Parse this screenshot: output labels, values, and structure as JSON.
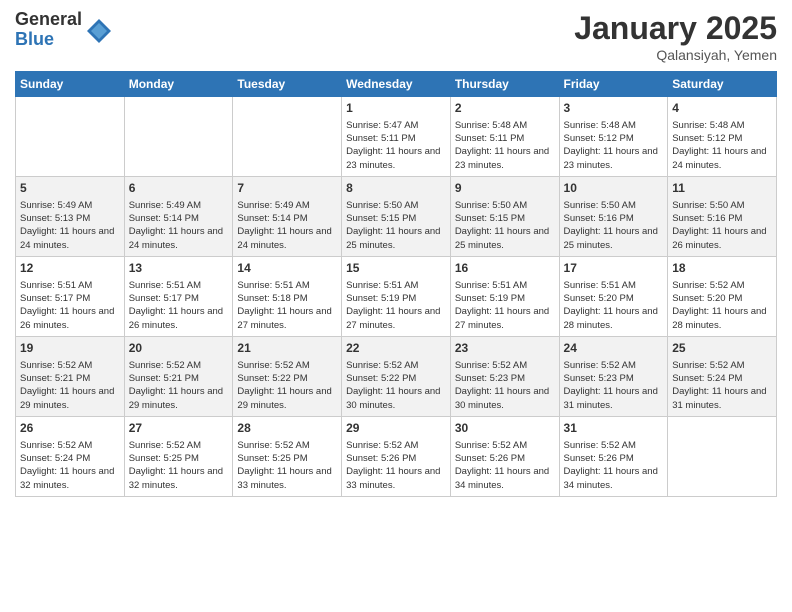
{
  "logo": {
    "general": "General",
    "blue": "Blue"
  },
  "header": {
    "month": "January 2025",
    "location": "Qalansiyah, Yemen"
  },
  "weekdays": [
    "Sunday",
    "Monday",
    "Tuesday",
    "Wednesday",
    "Thursday",
    "Friday",
    "Saturday"
  ],
  "weeks": [
    [
      {
        "day": "",
        "data": ""
      },
      {
        "day": "",
        "data": ""
      },
      {
        "day": "",
        "data": ""
      },
      {
        "day": "1",
        "sunrise": "Sunrise: 5:47 AM",
        "sunset": "Sunset: 5:11 PM",
        "daylight": "Daylight: 11 hours and 23 minutes."
      },
      {
        "day": "2",
        "sunrise": "Sunrise: 5:48 AM",
        "sunset": "Sunset: 5:11 PM",
        "daylight": "Daylight: 11 hours and 23 minutes."
      },
      {
        "day": "3",
        "sunrise": "Sunrise: 5:48 AM",
        "sunset": "Sunset: 5:12 PM",
        "daylight": "Daylight: 11 hours and 23 minutes."
      },
      {
        "day": "4",
        "sunrise": "Sunrise: 5:48 AM",
        "sunset": "Sunset: 5:12 PM",
        "daylight": "Daylight: 11 hours and 24 minutes."
      }
    ],
    [
      {
        "day": "5",
        "sunrise": "Sunrise: 5:49 AM",
        "sunset": "Sunset: 5:13 PM",
        "daylight": "Daylight: 11 hours and 24 minutes."
      },
      {
        "day": "6",
        "sunrise": "Sunrise: 5:49 AM",
        "sunset": "Sunset: 5:14 PM",
        "daylight": "Daylight: 11 hours and 24 minutes."
      },
      {
        "day": "7",
        "sunrise": "Sunrise: 5:49 AM",
        "sunset": "Sunset: 5:14 PM",
        "daylight": "Daylight: 11 hours and 24 minutes."
      },
      {
        "day": "8",
        "sunrise": "Sunrise: 5:50 AM",
        "sunset": "Sunset: 5:15 PM",
        "daylight": "Daylight: 11 hours and 25 minutes."
      },
      {
        "day": "9",
        "sunrise": "Sunrise: 5:50 AM",
        "sunset": "Sunset: 5:15 PM",
        "daylight": "Daylight: 11 hours and 25 minutes."
      },
      {
        "day": "10",
        "sunrise": "Sunrise: 5:50 AM",
        "sunset": "Sunset: 5:16 PM",
        "daylight": "Daylight: 11 hours and 25 minutes."
      },
      {
        "day": "11",
        "sunrise": "Sunrise: 5:50 AM",
        "sunset": "Sunset: 5:16 PM",
        "daylight": "Daylight: 11 hours and 26 minutes."
      }
    ],
    [
      {
        "day": "12",
        "sunrise": "Sunrise: 5:51 AM",
        "sunset": "Sunset: 5:17 PM",
        "daylight": "Daylight: 11 hours and 26 minutes."
      },
      {
        "day": "13",
        "sunrise": "Sunrise: 5:51 AM",
        "sunset": "Sunset: 5:17 PM",
        "daylight": "Daylight: 11 hours and 26 minutes."
      },
      {
        "day": "14",
        "sunrise": "Sunrise: 5:51 AM",
        "sunset": "Sunset: 5:18 PM",
        "daylight": "Daylight: 11 hours and 27 minutes."
      },
      {
        "day": "15",
        "sunrise": "Sunrise: 5:51 AM",
        "sunset": "Sunset: 5:19 PM",
        "daylight": "Daylight: 11 hours and 27 minutes."
      },
      {
        "day": "16",
        "sunrise": "Sunrise: 5:51 AM",
        "sunset": "Sunset: 5:19 PM",
        "daylight": "Daylight: 11 hours and 27 minutes."
      },
      {
        "day": "17",
        "sunrise": "Sunrise: 5:51 AM",
        "sunset": "Sunset: 5:20 PM",
        "daylight": "Daylight: 11 hours and 28 minutes."
      },
      {
        "day": "18",
        "sunrise": "Sunrise: 5:52 AM",
        "sunset": "Sunset: 5:20 PM",
        "daylight": "Daylight: 11 hours and 28 minutes."
      }
    ],
    [
      {
        "day": "19",
        "sunrise": "Sunrise: 5:52 AM",
        "sunset": "Sunset: 5:21 PM",
        "daylight": "Daylight: 11 hours and 29 minutes."
      },
      {
        "day": "20",
        "sunrise": "Sunrise: 5:52 AM",
        "sunset": "Sunset: 5:21 PM",
        "daylight": "Daylight: 11 hours and 29 minutes."
      },
      {
        "day": "21",
        "sunrise": "Sunrise: 5:52 AM",
        "sunset": "Sunset: 5:22 PM",
        "daylight": "Daylight: 11 hours and 29 minutes."
      },
      {
        "day": "22",
        "sunrise": "Sunrise: 5:52 AM",
        "sunset": "Sunset: 5:22 PM",
        "daylight": "Daylight: 11 hours and 30 minutes."
      },
      {
        "day": "23",
        "sunrise": "Sunrise: 5:52 AM",
        "sunset": "Sunset: 5:23 PM",
        "daylight": "Daylight: 11 hours and 30 minutes."
      },
      {
        "day": "24",
        "sunrise": "Sunrise: 5:52 AM",
        "sunset": "Sunset: 5:23 PM",
        "daylight": "Daylight: 11 hours and 31 minutes."
      },
      {
        "day": "25",
        "sunrise": "Sunrise: 5:52 AM",
        "sunset": "Sunset: 5:24 PM",
        "daylight": "Daylight: 11 hours and 31 minutes."
      }
    ],
    [
      {
        "day": "26",
        "sunrise": "Sunrise: 5:52 AM",
        "sunset": "Sunset: 5:24 PM",
        "daylight": "Daylight: 11 hours and 32 minutes."
      },
      {
        "day": "27",
        "sunrise": "Sunrise: 5:52 AM",
        "sunset": "Sunset: 5:25 PM",
        "daylight": "Daylight: 11 hours and 32 minutes."
      },
      {
        "day": "28",
        "sunrise": "Sunrise: 5:52 AM",
        "sunset": "Sunset: 5:25 PM",
        "daylight": "Daylight: 11 hours and 33 minutes."
      },
      {
        "day": "29",
        "sunrise": "Sunrise: 5:52 AM",
        "sunset": "Sunset: 5:26 PM",
        "daylight": "Daylight: 11 hours and 33 minutes."
      },
      {
        "day": "30",
        "sunrise": "Sunrise: 5:52 AM",
        "sunset": "Sunset: 5:26 PM",
        "daylight": "Daylight: 11 hours and 34 minutes."
      },
      {
        "day": "31",
        "sunrise": "Sunrise: 5:52 AM",
        "sunset": "Sunset: 5:26 PM",
        "daylight": "Daylight: 11 hours and 34 minutes."
      },
      {
        "day": "",
        "data": ""
      }
    ]
  ]
}
